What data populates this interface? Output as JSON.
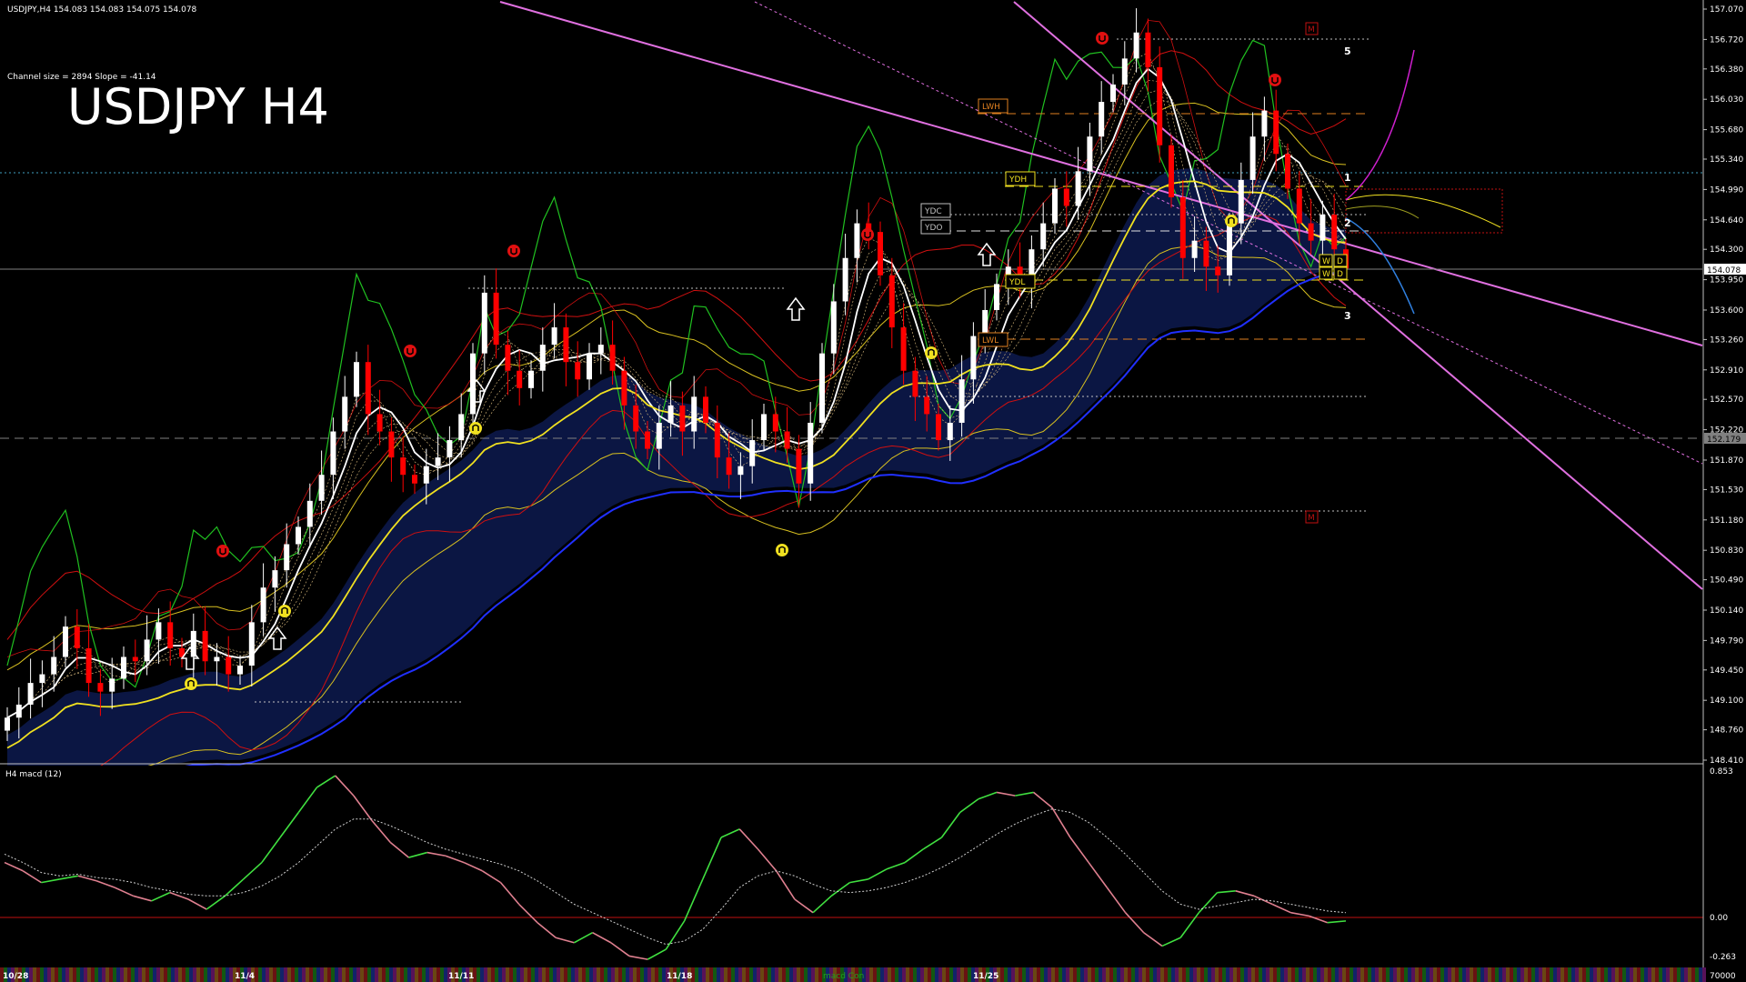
{
  "header": {
    "symbol_line": "USDJPY,H4  154.083 154.083 154.075 154.078",
    "channel_info": "Channel size = 2894 Slope = -41.14",
    "big_title": "USDJPY H4"
  },
  "colors": {
    "bg": "#000000",
    "bull": "#ffffff",
    "bear": "#ff0000",
    "channel": "#e070e0",
    "fast_ma": "#ffffff",
    "mid_ma": "#f0e020",
    "slow_ma": "#2030ff",
    "green_line": "#20c020",
    "envelope": "#d01010",
    "cloud": "#2040c0",
    "cloud_band": "#d8c020"
  },
  "price_axis": {
    "labels": [
      "157.070",
      "156.720",
      "156.380",
      "156.030",
      "155.680",
      "155.340",
      "154.990",
      "154.640",
      "154.300",
      "153.950",
      "153.600",
      "153.260",
      "152.910",
      "152.570",
      "152.220",
      "151.870",
      "151.530",
      "151.180",
      "150.830",
      "150.490",
      "150.140",
      "149.790",
      "149.450",
      "149.100",
      "148.760",
      "148.410"
    ],
    "current_price": "154.078",
    "dashed_level": "152.179"
  },
  "macd_panel": {
    "label": "H4  macd (12)",
    "axis_labels": [
      "0.853",
      "0.00",
      "-0.263"
    ]
  },
  "date_axis": {
    "labels": [
      "10/28",
      "11/4",
      "11/11",
      "11/18",
      "11/25"
    ],
    "right_label": "70000",
    "inline_label": "macd Con"
  },
  "level_tags": [
    "LWH",
    "YDH",
    "YDC",
    "YDO",
    "YDL",
    "LWL",
    "LWL",
    "LWH"
  ],
  "wd_tags": [
    "W",
    "D",
    "W",
    "D"
  ],
  "wave_numbers": [
    "5",
    "1",
    "2",
    "3"
  ],
  "marker_letters": [
    "M",
    "M"
  ],
  "chart_data": [
    {
      "type": "candlestick",
      "title": "USDJPY H4",
      "ylim": [
        148.41,
        157.07
      ],
      "grid": false,
      "series": [
        {
          "name": "price",
          "close_series": [
            148.9,
            149.05,
            149.3,
            149.4,
            149.6,
            149.95,
            149.7,
            149.3,
            149.2,
            149.35,
            149.6,
            149.55,
            149.8,
            150.0,
            149.7,
            149.6,
            149.9,
            149.55,
            149.6,
            149.4,
            149.5,
            150.0,
            150.4,
            150.6,
            150.9,
            151.1,
            151.4,
            151.7,
            152.2,
            152.6,
            153.0,
            152.4,
            152.2,
            151.9,
            151.7,
            151.6,
            151.8,
            151.9,
            152.1,
            152.4,
            153.1,
            153.8,
            153.2,
            152.9,
            152.7,
            152.9,
            153.2,
            153.4,
            153.0,
            152.8,
            153.1,
            153.2,
            152.9,
            152.5,
            152.2,
            152.0,
            152.3,
            152.5,
            152.2,
            152.6,
            152.3,
            151.9,
            151.7,
            151.8,
            152.1,
            152.4,
            152.2,
            152.0,
            151.6,
            152.3,
            153.1,
            153.7,
            154.2,
            154.6,
            154.5,
            154.0,
            153.4,
            152.9,
            152.6,
            152.4,
            152.1,
            152.3,
            152.8,
            153.3,
            153.6,
            153.9,
            154.1,
            153.9,
            154.3,
            154.6,
            155.0,
            154.8,
            155.2,
            155.6,
            156.0,
            156.2,
            156.5,
            156.8,
            156.4,
            155.5,
            154.9,
            154.2,
            154.4,
            154.1,
            154.0,
            154.6,
            155.1,
            155.6,
            155.9,
            155.4,
            155.0,
            154.6,
            154.4,
            154.7,
            154.3,
            154.08
          ]
        }
      ],
      "dashed_levels": [
        156.72,
        155.97,
        155.2,
        154.68,
        154.54,
        153.88,
        153.28,
        152.63,
        151.26
      ],
      "wave_labels": [
        "5",
        "1",
        "2",
        "3"
      ]
    },
    {
      "type": "line",
      "title": "H4  macd (12)",
      "ylim": [
        -0.263,
        0.853
      ],
      "grid": false,
      "series": [
        {
          "name": "macd",
          "values": [
            0.3,
            0.25,
            0.18,
            0.2,
            0.22,
            0.19,
            0.15,
            0.1,
            0.07,
            0.12,
            0.08,
            0.02,
            0.1,
            0.2,
            0.3,
            0.45,
            0.6,
            0.75,
            0.82,
            0.7,
            0.55,
            0.42,
            0.33,
            0.36,
            0.34,
            0.3,
            0.25,
            0.18,
            0.05,
            -0.06,
            -0.15,
            -0.18,
            -0.12,
            -0.18,
            -0.26,
            -0.28,
            -0.22,
            -0.05,
            0.2,
            0.45,
            0.5,
            0.38,
            0.25,
            0.08,
            0.0,
            0.1,
            0.18,
            0.2,
            0.26,
            0.3,
            0.38,
            0.45,
            0.6,
            0.68,
            0.72,
            0.7,
            0.72,
            0.63,
            0.45,
            0.3,
            0.15,
            0.0,
            -0.12,
            -0.2,
            -0.15,
            0.0,
            0.12,
            0.13,
            0.1,
            0.05,
            0.0,
            -0.02,
            -0.06,
            -0.05
          ]
        },
        {
          "name": "signal",
          "values": [
            0.35,
            0.3,
            0.24,
            0.22,
            0.23,
            0.21,
            0.2,
            0.18,
            0.15,
            0.13,
            0.11,
            0.1,
            0.1,
            0.12,
            0.16,
            0.22,
            0.3,
            0.4,
            0.5,
            0.56,
            0.56,
            0.52,
            0.47,
            0.42,
            0.38,
            0.35,
            0.32,
            0.29,
            0.25,
            0.19,
            0.12,
            0.05,
            0.0,
            -0.05,
            -0.1,
            -0.15,
            -0.19,
            -0.17,
            -0.1,
            0.02,
            0.15,
            0.22,
            0.25,
            0.22,
            0.17,
            0.13,
            0.12,
            0.13,
            0.15,
            0.18,
            0.22,
            0.27,
            0.33,
            0.4,
            0.47,
            0.53,
            0.58,
            0.62,
            0.6,
            0.54,
            0.45,
            0.35,
            0.24,
            0.13,
            0.05,
            0.02,
            0.04,
            0.06,
            0.08,
            0.07,
            0.05,
            0.03,
            0.01,
            0.0
          ]
        }
      ]
    }
  ]
}
